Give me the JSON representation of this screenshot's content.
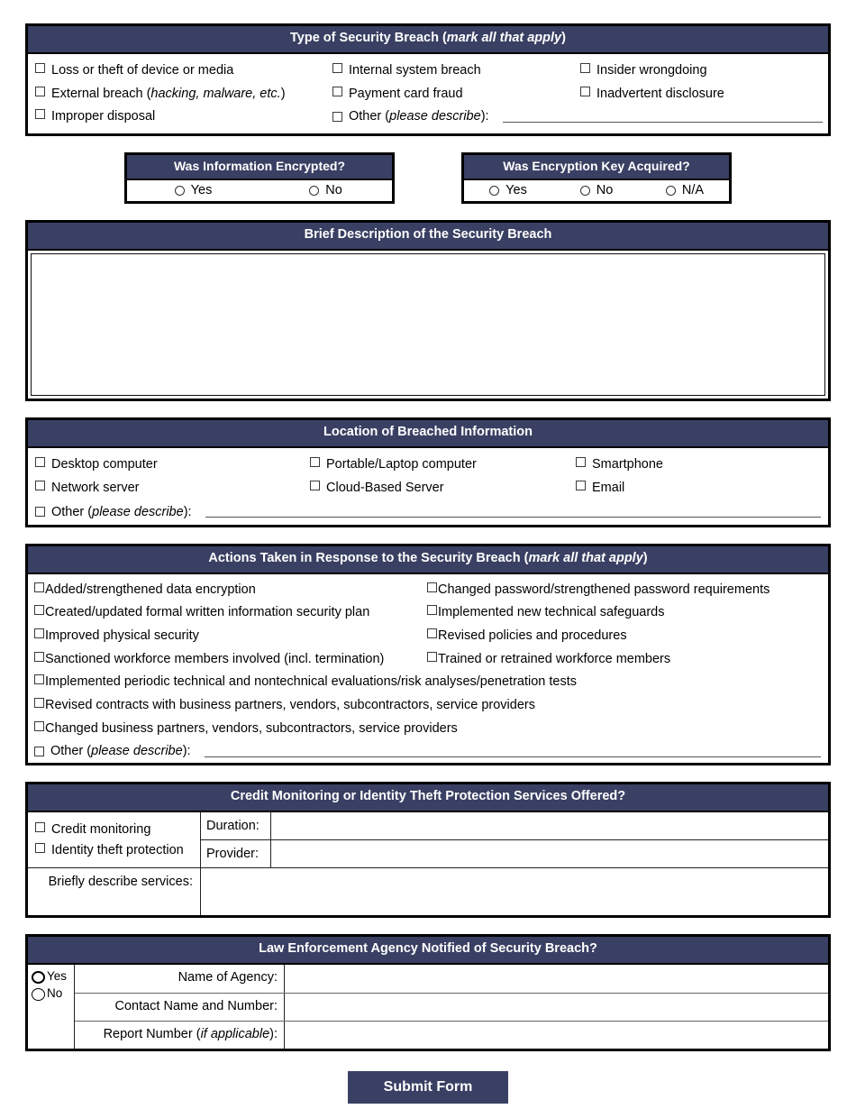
{
  "breach_type": {
    "header_main": "Type of Security Breach (",
    "header_em": "mark all that apply",
    "header_end": ")",
    "options": [
      "Loss or theft of device or media",
      "Internal system breach",
      "Insider wrongdoing",
      "External breach (",
      "Payment card fraud",
      "Inadvertent disclosure",
      "Improper disposal"
    ],
    "external_em": "hacking, malware, etc.",
    "external_end": ")",
    "other_label": "Other (",
    "other_em": "please describe",
    "other_end": "):",
    "other_value": ""
  },
  "encryption": {
    "info_encrypted": {
      "title": "Was Information Encrypted?",
      "options": [
        "Yes",
        "No"
      ]
    },
    "key_acquired": {
      "title": "Was Encryption Key Acquired?",
      "options": [
        "Yes",
        "No",
        "N/A"
      ]
    }
  },
  "description": {
    "title": "Brief Description of the Security Breach",
    "value": ""
  },
  "location": {
    "title": "Location of Breached Information",
    "options": [
      "Desktop computer",
      "Portable/Laptop computer",
      "Smartphone",
      "Network server",
      "Cloud-Based Server",
      "Email"
    ],
    "other_label": "Other (",
    "other_em": "please describe",
    "other_end": "):",
    "other_value": ""
  },
  "actions": {
    "header_main": "Actions Taken in Response to the Security Breach (",
    "header_em": "mark all that apply",
    "header_end": ")",
    "options": [
      "Added/strengthened data encryption",
      "Changed password/strengthened password requirements",
      "Created/updated formal written information security plan",
      "Implemented new technical safeguards",
      "Improved physical security",
      "Revised policies and procedures",
      "Sanctioned workforce members involved (incl. termination)",
      "Trained or retrained workforce members"
    ],
    "full_width_options": [
      "Implemented periodic technical and nontechnical evaluations/risk analyses/penetration tests",
      "Revised contracts with business partners, vendors, subcontractors, service providers",
      "Changed business partners, vendors, subcontractors, service providers"
    ],
    "other_label": "Other (",
    "other_em": "please describe",
    "other_end": "):",
    "other_value": ""
  },
  "credit": {
    "title": "Credit Monitoring or Identity Theft Protection Services Offered?",
    "options": [
      "Credit monitoring",
      "Identity theft protection"
    ],
    "duration_label": "Duration:",
    "duration_value": "",
    "provider_label": "Provider:",
    "provider_value": "",
    "describe_label": "Briefly describe services:",
    "describe_value": ""
  },
  "law": {
    "title": "Law Enforcement Agency Notified of Security Breach?",
    "yes_label": "Yes",
    "no_label": "No",
    "rows": [
      {
        "label_main": "Name of Agency:",
        "label_em": "",
        "label_end": "",
        "value": ""
      },
      {
        "label_main": "Contact Name and Number:",
        "label_em": "",
        "label_end": "",
        "value": ""
      },
      {
        "label_main": "Report Number (",
        "label_em": "if applicable",
        "label_end": "):",
        "value": ""
      }
    ]
  },
  "submit": {
    "label": "Submit Form"
  },
  "colors": {
    "header_bg": "#3a4063",
    "header_text": "#ffffff",
    "border": "#000000"
  }
}
